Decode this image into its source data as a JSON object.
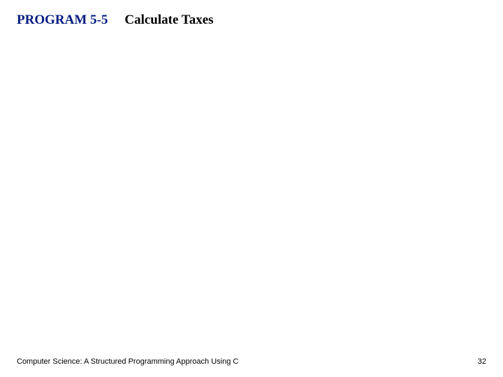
{
  "header": {
    "program_label": "PROGRAM 5-5",
    "program_title": "Calculate Taxes"
  },
  "footer": {
    "book_title": "Computer Science: A Structured Programming Approach Using C",
    "page_number": "32"
  }
}
